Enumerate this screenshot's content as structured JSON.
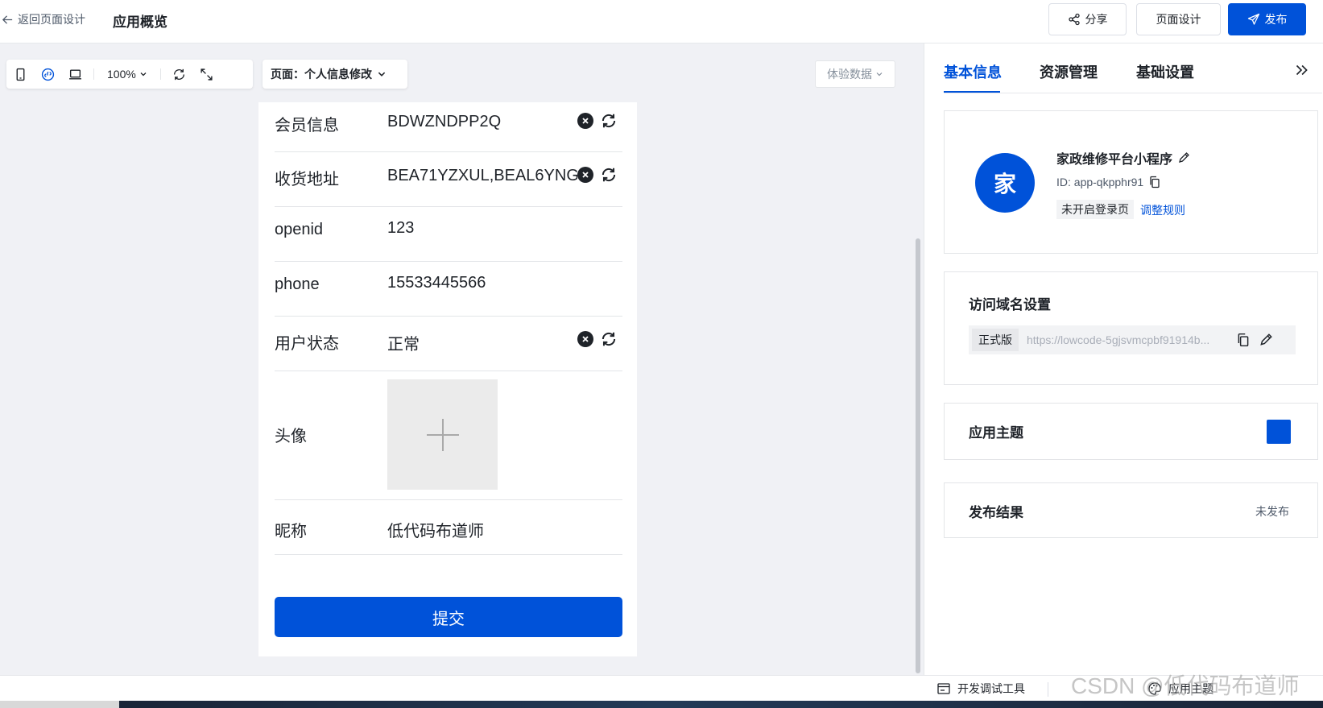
{
  "header": {
    "back_label": "返回页面设计",
    "title": "应用概览",
    "share_label": "分享",
    "page_design_label": "页面设计",
    "publish_label": "发布"
  },
  "toolbar": {
    "zoom": "100%",
    "page_select": {
      "prefix": "页面：",
      "value": "个人信息修改"
    },
    "experience_data_label": "体验数据"
  },
  "form": {
    "rows": [
      {
        "label": "会员信息",
        "value": "BDWZNDPP2Q"
      },
      {
        "label": "收货地址",
        "value": "BEA71YZXUL,BEAL6YNG"
      },
      {
        "label": "openid",
        "value": "123"
      },
      {
        "label": "phone",
        "value": "15533445566"
      },
      {
        "label": "用户状态",
        "value": "正常"
      },
      {
        "label": "头像",
        "value": ""
      },
      {
        "label": "昵称",
        "value": "低代码布道师"
      }
    ],
    "submit_label": "提交"
  },
  "right_panel": {
    "tabs": [
      "基本信息",
      "资源管理",
      "基础设置"
    ],
    "active_tab": 0,
    "app_card": {
      "avatar_char": "家",
      "app_name": "家政维修平台小程序",
      "app_id": "ID: app-qkpphr91",
      "login_tag": "未开启登录页",
      "adjust_link": "调整规则"
    },
    "domain_card": {
      "title": "访问域名设置",
      "env_tag": "正式版",
      "url": "https://lowcode-5gjsvmcpbf91914b..."
    },
    "theme_card": {
      "title": "应用主题",
      "color": "#0052d9"
    },
    "publish_card": {
      "title": "发布结果",
      "status": "未发布"
    }
  },
  "bottom_bar": {
    "dev_tools_label": "开发调试工具",
    "theme_label": "应用主题",
    "watermark": "CSDN @低代码布道师"
  },
  "colors": {
    "brand": "#0052d9",
    "text": "#1f2329",
    "muted": "#86909c"
  }
}
